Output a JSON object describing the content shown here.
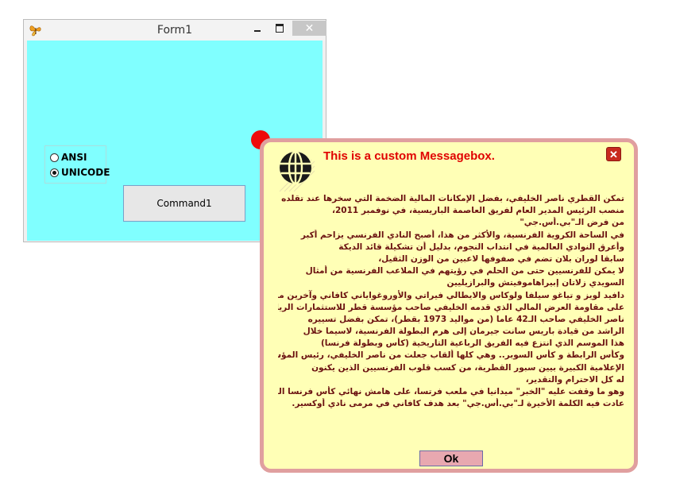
{
  "form": {
    "title": "Form1",
    "close_symbol": "✕",
    "icons": {
      "app": "butterfly-icon",
      "minimize": "minimize-icon",
      "maximize": "maximize-icon"
    },
    "radios": [
      {
        "label": "ANSI",
        "checked": false
      },
      {
        "label": "UNICODE",
        "checked": true
      }
    ],
    "command_label": "Command1",
    "colors": {
      "client_bg": "#80ffff"
    }
  },
  "messagebox": {
    "title": "This is a custom Messagebox.",
    "close_symbol": "✕",
    "icon": "globe-icon",
    "ok_label": "Ok",
    "colors": {
      "background": "#ffffb6",
      "border": "#e09f9f",
      "title": "#e00000",
      "text": "#6a1010"
    },
    "lines": [
      "تمكن القطري ناصر الخليفي، بفضل الإمكانات المالية الضخمة التي سخرها عند تقلده",
      "منصب الرئيس المدير العام لفريق العاصمة الباريسية، في نوفمبر 2011،",
      "من فرض الـ\"بي.أس.جي\"",
      "في الساحة الكروية الفرنسية، والأكثر من هذا، أصبح النادي الفرنسي يزاحم أكبر",
      "وأعرق النوادي العالمية في انتداب النجوم، بدليل أن تشكيلة قائد الديكة",
      "سابقا لوران بلان تضم في صفوفها لاعبين من الوزن الثقيل،",
      "لا يمكن للفرنسيين حتى من الحلم في رؤيتهم في الملاعب الفرنسية من أمثال",
      "السويدي زلاتان إبيراهاموفيتش والبرازيليين",
      "دافيد لويز و تياغو سيلفا ولوكاس والايطالي فيراتي والأوروغواياني كافاني وآخرين ممن لم يقدروا",
      "على مقاومة العرض المالي الذي قدمه الخليفي صاحب مؤسسة قطر للاستثمارات الرياضية.",
      "ناصر الخليفي صاحب الـ42 عاما (من مواليد 1973 بقطر)، تمكن بفضل تسييره",
      "الراشد من قيادة باريس سانت جيرمان إلى هرم البطولة الفرنسية، لاسيما خلال",
      "هذا الموسم الذي انتزع فيه الفريق الرباعية التاريخية (كأس وبطولة فرنسا)",
      "وكأس الرابطة و كأس السوبر.. وهي كلها ألقاب جعلت من ناصر الخليفي، رئيس المؤسسة",
      "الإعلامية الكبيرة بيين سبور القطرية، من كسب قلوب الفرنسيين الذين يكنون",
      "له كل الاحترام والتقدير،",
      "وهو ما وقفت عليه \"الخبر\" ميدانيا في ملعب فرتسا، على هامش نهائي كأس فرنسا الذي",
      "عادت فيه الكلمة الأخيرة لـ\"بي.أس.جي\" بعد هدف كافاني في مرمى نادي أوكسير."
    ]
  }
}
